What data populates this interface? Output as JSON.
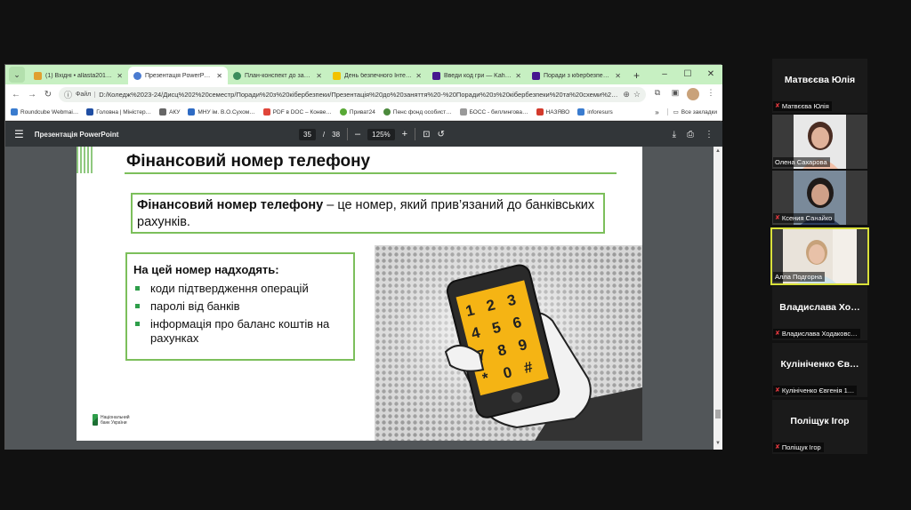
{
  "browser": {
    "tabs": [
      {
        "title": "(1) Вхідні • allasta2017@…",
        "fav": "#e0a030",
        "active": false
      },
      {
        "title": "Презентація PowerPoint",
        "fav": "#4a7bd1",
        "active": true
      },
      {
        "title": "План-конспект до занятт…",
        "fav": "#3a8c5c",
        "active": false
      },
      {
        "title": "День безпечного Інтерн…",
        "fav": "#f2c200",
        "active": false
      },
      {
        "title": "Введи код гри — Kahoot!",
        "fav": "#46178f",
        "active": false
      },
      {
        "title": "Поради з кібербезпеки …",
        "fav": "#46178f",
        "active": false
      }
    ],
    "new_tab": "+",
    "window_controls": {
      "minimize": "–",
      "maximize": "☐",
      "close": "✕"
    },
    "address": {
      "chip": "Файл",
      "url": "D:/Коледж%2023-24/Дисц%202%20семестр/Поради%20з%20кібербезпеки/Презентація%20до%20заняття%20-%20Поради%20з%20кібербезпеки%20та%20схеми%20..."
    },
    "bookmarks": [
      {
        "label": "Roundcube Webmai…",
        "color": "#3a7ccf"
      },
      {
        "label": "Головна | Міністер…",
        "color": "#1f4ea3"
      },
      {
        "label": "АКУ",
        "color": "#666666"
      },
      {
        "label": "МНУ ім. В.О.Сухом…",
        "color": "#2e6bc4"
      },
      {
        "label": "PDF в DOC – Конве…",
        "color": "#e0453a"
      },
      {
        "label": "Приват24",
        "color": "#58a935"
      },
      {
        "label": "Пенс фонд особист…",
        "color": "#4c8a3d"
      },
      {
        "label": "БОСС - биллингова…",
        "color": "#999999"
      },
      {
        "label": "НАЗЯВО",
        "color": "#d33a2c"
      },
      {
        "label": "inforesurs",
        "color": "#3a7ccf"
      }
    ],
    "bookmarks_more": "»",
    "all_bookmarks": "Все закладки"
  },
  "pdf": {
    "title": "Презентація PowerPoint",
    "page_current": "35",
    "page_separator": "/",
    "page_total": "38",
    "zoom": "125%",
    "zoom_out": "–",
    "zoom_in": "+"
  },
  "slide": {
    "title": "Фінансовий номер телефону",
    "definition_term": "Фінансовий номер телефону",
    "definition_rest": " – це номер, який прив’язаний до банківських рахунків.",
    "list_heading": "На цей номер надходять:",
    "list_items": [
      "коди підтвердження операцій",
      "паролі від банків",
      "інформація про баланс коштів на  рахунках"
    ],
    "logo_line1": "Національний",
    "logo_line2": "банк України",
    "keypad": [
      "1",
      "2",
      "3",
      "4",
      "5",
      "6",
      "7",
      "8",
      "9",
      "*",
      "0",
      "#"
    ]
  },
  "participants": [
    {
      "big_name": "Матвєєва Юлія",
      "label": "Матвєєва Юлія",
      "video": false,
      "active": false
    },
    {
      "big_name": "",
      "label": "Олена Сахарова",
      "video": true,
      "active": false
    },
    {
      "big_name": "",
      "label": "Ксения Санайко",
      "video": true,
      "active": false
    },
    {
      "big_name": "",
      "label": "Алла Подгорна",
      "video": true,
      "active": true
    },
    {
      "big_name": "Владислава Хо…",
      "label": "Владислава Ходаковс…",
      "video": false,
      "active": false
    },
    {
      "big_name": "Кулініченко Єв…",
      "label": "Кулініченко Євгенія 1…",
      "video": false,
      "active": false
    },
    {
      "big_name": "Поліщук Ігор",
      "label": "Поліщук Ігор",
      "video": false,
      "active": false
    }
  ],
  "colors": {
    "tab_strip": "#c7f0c2",
    "slide_accent_green": "#7cbf5b",
    "bullet_green": "#2e9e4a",
    "phone_screen": "#f5b414",
    "active_speaker_border": "#d9e03a",
    "mic_muted": "#e0383e"
  }
}
